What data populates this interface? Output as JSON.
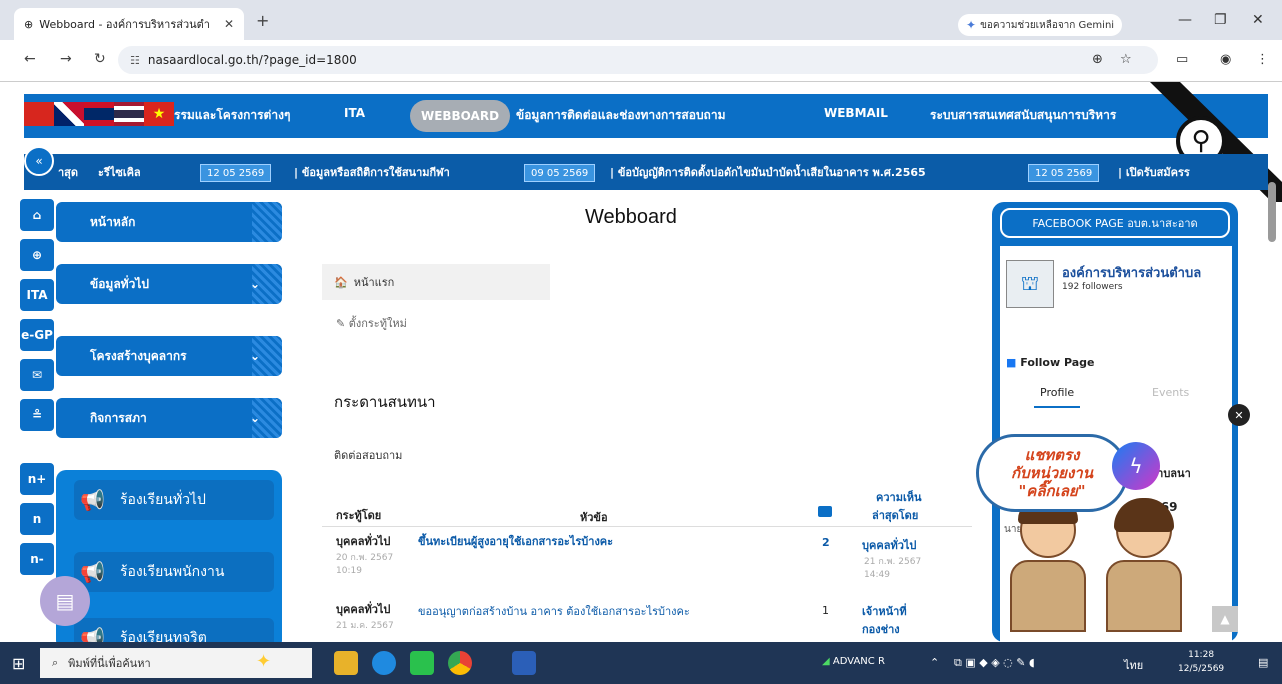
{
  "browser": {
    "tab_title": "Webboard - องค์การบริหารส่วนตำบล",
    "gemini_label": "ขอความช่วยเหลือจาก Gemini",
    "url": "nasaardlocal.go.th/?page_id=1800"
  },
  "nav": {
    "items": [
      "รรมและโครงการต่างๆ",
      "ITA",
      "WEBBOARD",
      "ข้อมูลการติดต่อและช่องทางการสอบถาม",
      "WEBMAIL",
      "ระบบสารสนเทศสนับสนุนการบริหาร"
    ]
  },
  "ticker": {
    "label": "าสุด",
    "items": [
      {
        "text": "ะรีไซเคิล"
      },
      {
        "date": "12 05 2569",
        "text": "ข้อมูลหรือสถิติการใช้สนามกีฬา"
      },
      {
        "date": "09 05 2569",
        "text": "ข้อบัญญัติการติดตั้งบ่อดักไขมันบำบัดน้ำเสียในอาคาร พ.ศ.2565"
      },
      {
        "date": "12 05 2569",
        "text": "เปิดรับสมัครร"
      }
    ]
  },
  "rail": [
    "«",
    "⌂",
    "⊕",
    "ITA",
    "e-GP",
    "✉",
    "≗",
    "n+",
    "n",
    "n-"
  ],
  "menu": {
    "items": [
      {
        "label": "หน้าหลัก",
        "chevron": false
      },
      {
        "label": "ข้อมูลทั่วไป",
        "chevron": true
      },
      {
        "label": "โครงสร้างบุคลากร",
        "chevron": true
      },
      {
        "label": "กิจการสภา",
        "chevron": true
      }
    ],
    "complaints": [
      "ร้องเรียนทั่วไป",
      "ร้องเรียนพนักงาน",
      "ร้องเรียนทุจริต"
    ]
  },
  "main": {
    "title": "Webboard",
    "breadcrumb": "หน้าแรก",
    "new_thread": "ตั้งกระทู้ใหม่",
    "section": "กระดานสนทนา",
    "subsection": "ติดต่อสอบถาม",
    "headers": {
      "author": "กระทู้โดย",
      "topic": "หัวข้อ",
      "last_1": "ความเห็น",
      "last_2": "ล่าสุดโดย"
    },
    "rows": [
      {
        "author": "บุคคลทั่วไป",
        "date": "20 ก.พ. 2567",
        "time": "10:19",
        "topic": "ขึ้นทะเบียนผู้สูงอายุใช้เอกสารอะไรบ้างคะ",
        "count": "2",
        "last_by": "บุคคลทั่วไป",
        "last_date": "21 ก.พ. 2567",
        "last_time": "14:49"
      },
      {
        "author": "บุคคลทั่วไป",
        "date": "21 ม.ค. 2567",
        "time": "",
        "topic": "ขออนุญาตก่อสร้างบ้าน อาคาร ต้องใช้เอกสารอะไรบ้างคะ",
        "count": "1",
        "last_by": "เจ้าหน้าที่",
        "last_by2": "กองช่าง",
        "last_date": "",
        "last_time": ""
      }
    ]
  },
  "facebook": {
    "header": "FACEBOOK PAGE อบต.นาสะอาด",
    "page_name": "องค์การบริหารส่วนตำบล",
    "followers": "192 followers",
    "follow": "Follow Page",
    "tabs": [
      "Profile",
      "Events"
    ],
    "post_title": "ตำบลนา",
    "post_date": "ม 2569",
    "post_text": "นายช่าง"
  },
  "chat_bubble": [
    "แชทตรง",
    "กับหน่วยงาน",
    "\"คลิ๊กเลย\""
  ],
  "taskbar": {
    "search_placeholder": "พิมพ์ที่นี่เพื่อค้นหา",
    "widget": "ADVANC R",
    "lang": "ไทย",
    "time": "11:28",
    "date": "12/5/2569"
  },
  "colors": {
    "primary": "#0b6fc6",
    "dark": "#0b5ca8",
    "taskbar": "#1f3555"
  }
}
